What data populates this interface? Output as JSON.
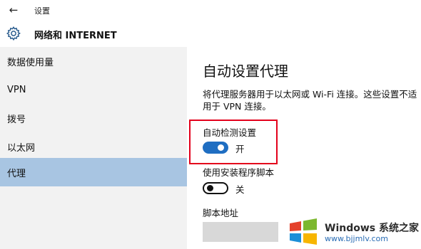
{
  "window": {
    "title": "设置",
    "back_icon": "arrow-left-icon"
  },
  "header": {
    "title": "网络和 INTERNET",
    "icon": "gear-icon"
  },
  "sidebar": {
    "items": [
      {
        "label": "数据使用量",
        "selected": false
      },
      {
        "label": "VPN",
        "selected": false
      },
      {
        "label": "拨号",
        "selected": false
      },
      {
        "label": "以太网",
        "selected": false
      },
      {
        "label": "代理",
        "selected": true
      }
    ]
  },
  "content": {
    "title": "自动设置代理",
    "description": "将代理服务器用于以太网或 Wi-Fi 连接。这些设置不适用于 VPN 连接。",
    "auto_detect": {
      "label": "自动检测设置",
      "state": "开",
      "on": true
    },
    "setup_script": {
      "label": "使用安装程序脚本",
      "state": "关",
      "on": false
    },
    "script_address": {
      "label": "脚本地址",
      "value": ""
    }
  },
  "colors": {
    "accent": "#1f6ec2",
    "sidebar_selected": "#a8c5e2",
    "highlight": "#e3001b"
  },
  "watermark": {
    "text": "Windows 系统之家",
    "url": "www.bjjmlv.com"
  }
}
